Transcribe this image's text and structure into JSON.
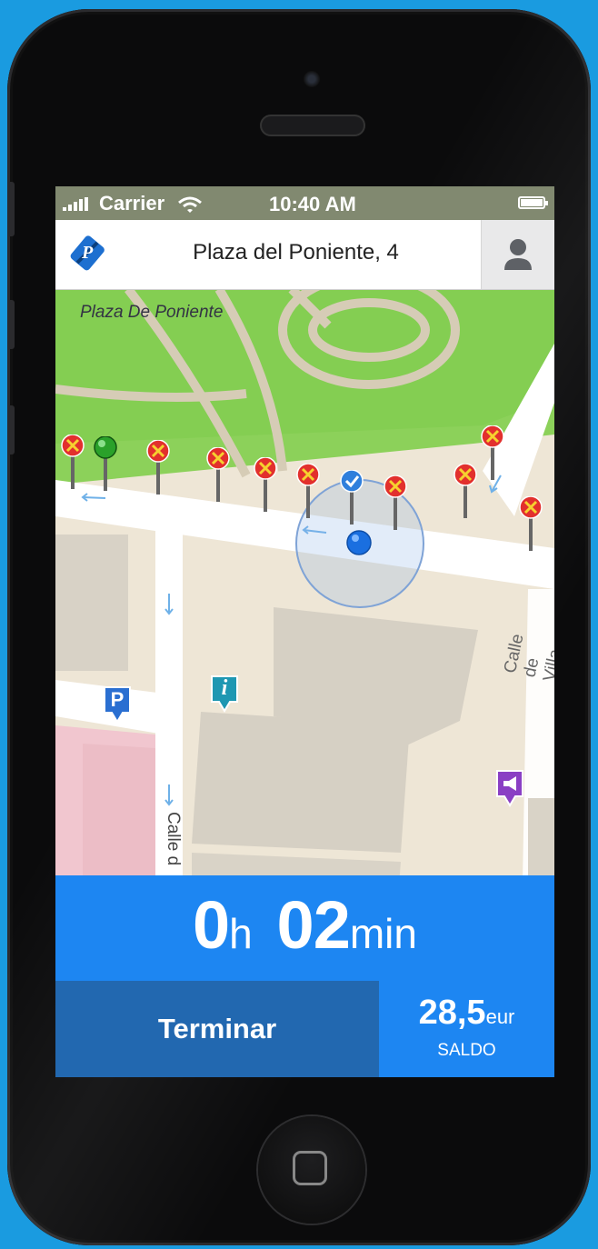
{
  "status_bar": {
    "carrier": "Carrier",
    "time": "10:40 AM"
  },
  "nav": {
    "address": "Plaza del Poniente, 4",
    "logo_letter": "P"
  },
  "map": {
    "street_labels": [
      "Plaza De Poniente",
      "Calle de Villa",
      "Calle d"
    ],
    "parking_letter": "P",
    "info_letter": "i"
  },
  "timer": {
    "hours": "0",
    "hours_unit": "h",
    "minutes": "02",
    "minutes_unit": "min"
  },
  "actions": {
    "end_label": "Terminar"
  },
  "balance": {
    "amount": "28,5",
    "currency": "eur",
    "label": "SALDO"
  },
  "colors": {
    "accent_blue": "#1d86f2",
    "dark_blue": "#2268b0",
    "no_parking_red": "#e2302d",
    "free_green": "#2aa12a"
  }
}
